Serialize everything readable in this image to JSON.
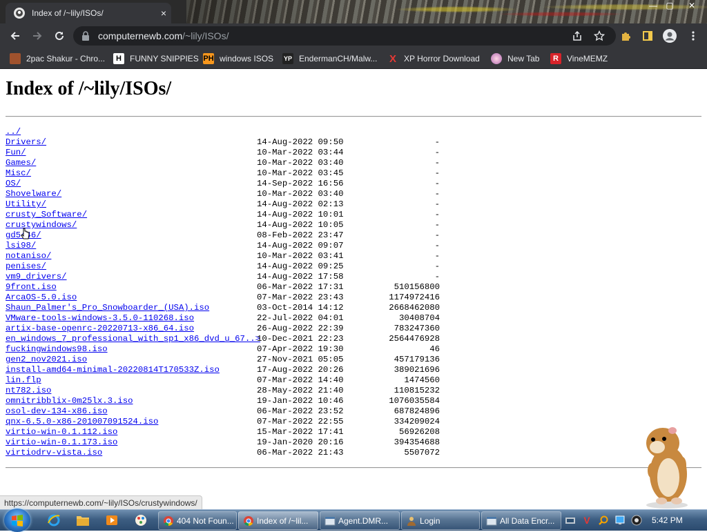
{
  "browser": {
    "tab": {
      "title": "Index of /~lily/ISOs/",
      "close": "×"
    },
    "window_controls": {
      "minimize": "—",
      "maximize": "▢",
      "close": "✕"
    },
    "address": {
      "host": "computernewb.com",
      "path": "/~lily/ISOs/"
    },
    "bookmarks": [
      {
        "label": "2pac Shakur - Chro...",
        "icon": "bookmark-favicon-2pac"
      },
      {
        "label": "FUNNY SNIPPIES",
        "icon": "bookmark-favicon-h"
      },
      {
        "label": "windows ISOS",
        "icon": "bookmark-favicon-ph"
      },
      {
        "label": "EndermanCH/Malw...",
        "icon": "bookmark-favicon-yp"
      },
      {
        "label": "XP Horror Download",
        "icon": "bookmark-favicon-x"
      },
      {
        "label": "New Tab",
        "icon": "bookmark-favicon-newtab"
      },
      {
        "label": "VineMEMZ",
        "icon": "bookmark-favicon-r"
      }
    ],
    "status_url": "https://computernewb.com/~lily/ISOs/crustywindows/"
  },
  "page": {
    "heading": "Index of /~lily/ISOs/",
    "entries": [
      {
        "name": "../",
        "date": "",
        "size": ""
      },
      {
        "name": "Drivers/",
        "date": "14-Aug-2022 09:50",
        "size": "-"
      },
      {
        "name": "Fun/",
        "date": "10-Mar-2022 03:44",
        "size": "-"
      },
      {
        "name": "Games/",
        "date": "10-Mar-2022 03:40",
        "size": "-"
      },
      {
        "name": "Misc/",
        "date": "10-Mar-2022 03:45",
        "size": "-"
      },
      {
        "name": "OS/",
        "date": "14-Sep-2022 16:56",
        "size": "-"
      },
      {
        "name": "Shovelware/",
        "date": "10-Mar-2022 03:40",
        "size": "-"
      },
      {
        "name": "Utility/",
        "date": "14-Aug-2022 02:13",
        "size": "-"
      },
      {
        "name": "crusty_Software/",
        "date": "14-Aug-2022 10:01",
        "size": "-"
      },
      {
        "name": "crustywindows/",
        "date": "14-Aug-2022 10:05",
        "size": "-"
      },
      {
        "name": "gd5446/",
        "date": "08-Feb-2022 23:47",
        "size": "-"
      },
      {
        "name": "lsi98/",
        "date": "14-Aug-2022 09:07",
        "size": "-"
      },
      {
        "name": "notaniso/",
        "date": "10-Mar-2022 03:41",
        "size": "-"
      },
      {
        "name": "penises/",
        "date": "14-Aug-2022 09:25",
        "size": "-"
      },
      {
        "name": "vm9_drivers/",
        "date": "14-Aug-2022 17:58",
        "size": "-"
      },
      {
        "name": "9front.iso",
        "date": "06-Mar-2022 17:31",
        "size": "510156800"
      },
      {
        "name": "ArcaOS-5.0.iso",
        "date": "07-Mar-2022 23:43",
        "size": "1174972416"
      },
      {
        "name": "Shaun_Palmer's_Pro_Snowboarder_(USA).iso",
        "date": "03-Oct-2014 14:12",
        "size": "2668462080"
      },
      {
        "name": "VMware-tools-windows-3.5.0-110268.iso",
        "date": "22-Jul-2022 04:01",
        "size": "30408704"
      },
      {
        "name": "artix-base-openrc-20220713-x86_64.iso",
        "date": "26-Aug-2022 22:39",
        "size": "783247360"
      },
      {
        "name": "en_windows_7_professional_with_sp1_x86_dvd_u_67..>",
        "date": "10-Dec-2021 22:23",
        "size": "2564476928"
      },
      {
        "name": "fuckingwindows98.iso",
        "date": "07-Apr-2022 19:30",
        "size": "46"
      },
      {
        "name": "gen2_nov2021.iso",
        "date": "27-Nov-2021 05:05",
        "size": "457179136"
      },
      {
        "name": "install-amd64-minimal-20220814T170533Z.iso",
        "date": "17-Aug-2022 20:26",
        "size": "389021696"
      },
      {
        "name": "lin.flp",
        "date": "07-Mar-2022 14:40",
        "size": "1474560"
      },
      {
        "name": "nt782.iso",
        "date": "28-May-2022 21:40",
        "size": "110815232"
      },
      {
        "name": "omnitribblix-0m25lx.3.iso",
        "date": "19-Jan-2022 10:46",
        "size": "1076035584"
      },
      {
        "name": "osol-dev-134-x86.iso",
        "date": "06-Mar-2022 23:52",
        "size": "687824896"
      },
      {
        "name": "qnx-6.5.0-x86-201007091524.iso",
        "date": "07-Mar-2022 22:55",
        "size": "334209024"
      },
      {
        "name": "virtio-win-0.1.112.iso",
        "date": "15-Mar-2022 17:41",
        "size": "56926208"
      },
      {
        "name": "virtio-win-0.1.173.iso",
        "date": "19-Jan-2020 20:16",
        "size": "394354688"
      },
      {
        "name": "virtiodrv-vista.iso",
        "date": "06-Mar-2022 21:43",
        "size": "5507072"
      }
    ]
  },
  "taskbar": {
    "tasks": [
      {
        "label": "404 Not Foun...",
        "icon": "chrome-icon",
        "active": false
      },
      {
        "label": "Index of /~lil...",
        "icon": "chrome-icon",
        "active": true
      },
      {
        "label": "Agent.DMR...",
        "icon": "window-icon",
        "active": false
      },
      {
        "label": "Login",
        "icon": "user-icon",
        "active": false
      },
      {
        "label": "All Data Encr...",
        "icon": "window-icon",
        "active": false
      }
    ],
    "clock": "5:42 PM"
  },
  "colors": {
    "link": "#0000ee",
    "chrome_dark": "#35363a",
    "taskbar": "#3d5e82"
  }
}
